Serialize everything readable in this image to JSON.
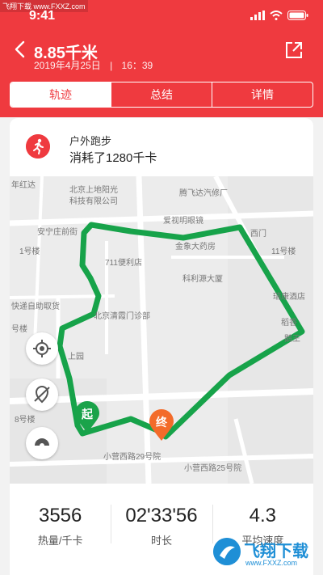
{
  "watermark_top": "飞翔下载 www.FXXZ.com",
  "status_bar": {
    "time": "9:41"
  },
  "header": {
    "title": "8.85千米",
    "date": "2019年4月25日",
    "separator": "|",
    "time": "16：39"
  },
  "tabs": [
    {
      "label": "轨迹",
      "active": true
    },
    {
      "label": "总结",
      "active": false
    },
    {
      "label": "详情",
      "active": false
    }
  ],
  "activity": {
    "type": "户外跑步",
    "calories_text": "消耗了1280千卡"
  },
  "map": {
    "labels": [
      "年红达",
      "北京上地阳光",
      "科技有限公司",
      "腾飞达汽修厂",
      "爱视明眼镜",
      "西门",
      "安宁庄前街",
      "金象大药房",
      "11号楼",
      "1号楼",
      "711便利店",
      "科利源大厦",
      "瑞康酒店",
      "快递自助取货",
      "北京清霞门诊部",
      "稻香",
      "号楼",
      "鹅王",
      "上园",
      "8号楼",
      "小营西路29号院",
      "小营西路25号院"
    ],
    "start_marker": "起",
    "end_marker": "终",
    "route_color": "#17a34a",
    "start_color": "#1aa34a",
    "end_color": "#f36b2a"
  },
  "stats": [
    {
      "value": "3556",
      "label": "热量/千卡"
    },
    {
      "value": "02'33'56",
      "label": "时长"
    },
    {
      "value": "4.3",
      "label": "平均速度"
    }
  ],
  "watermark_bottom": {
    "title": "飞翔下载",
    "url": "www.FXXZ.com"
  },
  "colors": {
    "accent": "#ef3a3f"
  }
}
